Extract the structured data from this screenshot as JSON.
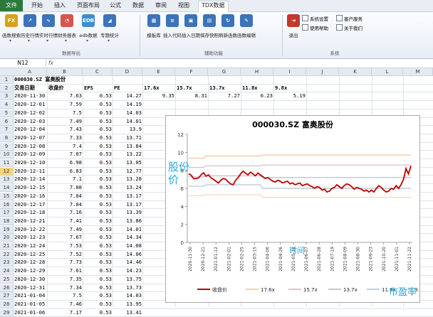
{
  "menu": {
    "items": [
      "文件",
      "开始",
      "插入",
      "页面布局",
      "公式",
      "数据",
      "审阅",
      "视图",
      "TDX数据"
    ]
  },
  "ribbon": {
    "buttons": [
      {
        "icon": "FX",
        "label": "函数搜索",
        "color": "#d7a21a"
      },
      {
        "icon": "↗",
        "label": "历史行情",
        "color": "#3b74b8"
      },
      {
        "icon": "∿",
        "label": "实时行情",
        "color": "#3b74b8"
      },
      {
        "icon": "◔",
        "label": "财务报表",
        "color": "#d9534f"
      },
      {
        "icon": "EDB",
        "label": "edb数据",
        "color": "#3b8fd0"
      },
      {
        "icon": "◢",
        "label": "专题统计",
        "color": "#3b74b8"
      },
      {
        "icon": "▦",
        "label": "模板库",
        "color": "#3b74b8"
      },
      {
        "icon": "≡",
        "label": "插入代码",
        "color": "#3b74b8"
      },
      {
        "icon": "▣",
        "label": "插入日期",
        "color": "#3b74b8"
      },
      {
        "icon": "▤",
        "label": "保存快照",
        "color": "#3b74b8"
      },
      {
        "icon": "↻",
        "label": "刷新函数",
        "color": "#3b74b8"
      },
      {
        "icon": "✎",
        "label": "函数编辑",
        "color": "#3b74b8"
      },
      {
        "icon": "⇥",
        "label": "退出",
        "color": "#c0392b"
      }
    ],
    "small_buttons": [
      "系统设置",
      "使用帮助",
      "客户服务",
      "关于我们"
    ],
    "groups": [
      "数据导出",
      "辅助功能",
      "系统"
    ]
  },
  "formula_bar": {
    "name_box": "N12",
    "fx": "fx"
  },
  "sheet": {
    "columns": [
      "A",
      "B",
      "C",
      "D",
      "E",
      "F",
      "G",
      "H",
      "I",
      "J",
      "K",
      "L",
      "M"
    ],
    "selected_row": "12",
    "header_row1": "000030.SZ  富奥股份",
    "header_row2": [
      "交易日期",
      "收盘价",
      "EPS",
      "PE"
    ],
    "pe_levels": [
      "17.6x",
      "15.7x",
      "13.7x",
      "11.8x",
      "9.8x"
    ],
    "pe_prices": [
      "9.35",
      "8.31",
      "7.27",
      "6.23",
      "5.19"
    ],
    "rows": [
      [
        "2020-11-30",
        "7.63",
        "0.53",
        "14.27"
      ],
      [
        "2020-12-01",
        "7.59",
        "0.53",
        "14.19"
      ],
      [
        "2020-12-02",
        "7.5",
        "0.53",
        "14.03"
      ],
      [
        "2020-12-03",
        "7.49",
        "0.53",
        "14.01"
      ],
      [
        "2020-12-04",
        "7.43",
        "0.53",
        "13.9"
      ],
      [
        "2020-12-07",
        "7.33",
        "0.53",
        "13.71"
      ],
      [
        "2020-12-08",
        "7.4",
        "0.53",
        "13.84"
      ],
      [
        "2020-12-09",
        "7.07",
        "0.53",
        "13.22"
      ],
      [
        "2020-12-10",
        "6.98",
        "0.53",
        "13.05"
      ],
      [
        "2020-12-11",
        "6.83",
        "0.53",
        "12.77"
      ],
      [
        "2020-12-14",
        "7.1",
        "0.53",
        "13.28"
      ],
      [
        "2020-12-15",
        "7.08",
        "0.53",
        "13.24"
      ],
      [
        "2020-12-16",
        "7.04",
        "0.53",
        "13.17"
      ],
      [
        "2020-12-17",
        "7.04",
        "0.53",
        "13.17"
      ],
      [
        "2020-12-18",
        "7.16",
        "0.53",
        "13.39"
      ],
      [
        "2020-12-21",
        "7.41",
        "0.53",
        "13.86"
      ],
      [
        "2020-12-22",
        "7.49",
        "0.53",
        "14.01"
      ],
      [
        "2020-12-23",
        "7.67",
        "0.53",
        "14.34"
      ],
      [
        "2020-12-24",
        "7.53",
        "0.53",
        "14.08"
      ],
      [
        "2020-12-25",
        "7.52",
        "0.53",
        "14.06"
      ],
      [
        "2020-12-28",
        "7.73",
        "0.53",
        "14.46"
      ],
      [
        "2020-12-29",
        "7.61",
        "0.53",
        "14.23"
      ],
      [
        "2020-12-30",
        "7.35",
        "0.53",
        "13.75"
      ],
      [
        "2020-12-31",
        "7.34",
        "0.53",
        "13.73"
      ],
      [
        "2021-01-04",
        "7.5",
        "0.53",
        "14.03"
      ],
      [
        "2021-01-05",
        "7.46",
        "0.53",
        "13.95"
      ],
      [
        "2021-01-06",
        "7.17",
        "0.53",
        "13.41"
      ]
    ]
  },
  "chart_data": {
    "type": "line",
    "title": "000030.SZ  富奥股份",
    "ylim": [
      0,
      12
    ],
    "yticks": [
      "0",
      "2",
      "4",
      "6",
      "8",
      "10",
      "12"
    ],
    "x_tick_labels": [
      "2020-11-30",
      "2020-12-21",
      "2021-01-12",
      "2021-02-01",
      "2021-02-25",
      "2021-03-15",
      "2021-04-06",
      "2021-04-26",
      "2021-05-18",
      "2021-06-07",
      "2021-06-28",
      "2021-07-19",
      "2021-08-09",
      "2021-08-30",
      "2021-09-23",
      "2021-10-20",
      "2021-11-01",
      "2021-11-22"
    ],
    "series": [
      {
        "name": "收盘价",
        "color": "#c00000",
        "values": [
          7.63,
          7.45,
          7.07,
          7.1,
          7.16,
          7.5,
          7.73,
          7.35,
          7.5,
          7.17,
          7.0,
          6.8,
          6.6,
          6.9,
          7.1,
          7.0,
          6.7,
          6.5,
          6.4,
          6.9,
          7.2,
          7.6,
          7.9,
          7.7,
          7.5,
          7.8,
          7.6,
          7.4,
          7.7,
          7.5,
          7.3,
          7.1,
          7.2,
          7.0,
          6.8,
          6.7,
          6.9,
          6.8,
          6.6,
          6.7,
          6.8,
          6.5,
          6.6,
          6.4,
          6.5,
          6.6,
          6.3,
          6.4,
          6.5,
          6.3,
          6.2,
          6.0,
          6.2,
          6.1,
          5.8,
          5.9,
          5.6,
          5.7,
          6.0,
          6.1,
          6.4,
          6.2,
          6.0,
          6.3,
          6.5,
          6.4,
          6.2,
          5.9,
          6.1,
          6.0,
          5.9,
          5.7,
          5.8,
          5.6,
          5.8,
          5.6,
          6.0,
          6.3,
          6.1,
          5.8,
          5.6,
          5.7,
          6.0,
          5.9,
          6.3,
          6.0,
          6.4,
          7.0,
          8.2,
          7.6,
          8.5
        ]
      },
      {
        "name": "17.6x",
        "color": "#f0b27a",
        "values": [
          9.35,
          9.35,
          9.35,
          9.35,
          9.35,
          9.35,
          9.35,
          9.6,
          9.6,
          9.6,
          9.6,
          9.6,
          9.6,
          9.6,
          9.6,
          9.6,
          9.6,
          9.6,
          9.6,
          9.6,
          9.6,
          9.6,
          9.6,
          9.6,
          9.6,
          9.6,
          9.6,
          9.6,
          9.6,
          9.6,
          9.7,
          9.7,
          9.7,
          9.7,
          9.7,
          9.7,
          9.7,
          9.7,
          9.7,
          9.7,
          9.7,
          9.7,
          9.7,
          9.7,
          9.7,
          9.7,
          9.7,
          9.7,
          9.7,
          9.7,
          9.7,
          9.7,
          9.7,
          9.7,
          9.7,
          9.7,
          9.7,
          9.7,
          9.7,
          9.7,
          9.7,
          9.7,
          9.7,
          9.7,
          9.7,
          9.7,
          9.7,
          9.7,
          9.7,
          9.7,
          9.7,
          9.7,
          9.7,
          9.7,
          9.7,
          9.7,
          9.7,
          9.7,
          9.7,
          9.7,
          9.7,
          9.7,
          9.7,
          9.7,
          9.7,
          9.7,
          9.7,
          9.7,
          9.7,
          9.7,
          9.7
        ]
      },
      {
        "name": "15.7x",
        "color": "#c9a4a4",
        "values": [
          8.31,
          8.31,
          8.31,
          8.31,
          8.31,
          8.31,
          8.31,
          8.5,
          8.5,
          8.5,
          8.5,
          8.5,
          8.5,
          8.5,
          8.5,
          8.5,
          8.5,
          8.5,
          8.5,
          8.5,
          8.5,
          8.5,
          8.5,
          8.5,
          8.5,
          8.5,
          8.5,
          8.5,
          8.5,
          8.5,
          8.6,
          8.6,
          8.6,
          8.6,
          8.6,
          8.6,
          8.6,
          8.6,
          8.6,
          8.6,
          8.6,
          8.6,
          8.6,
          8.6,
          8.6,
          8.6,
          8.6,
          8.6,
          8.6,
          8.6,
          8.6,
          8.6,
          8.6,
          8.6,
          8.6,
          8.6,
          8.6,
          8.6,
          8.6,
          8.6,
          8.6,
          8.6,
          8.6,
          8.6,
          8.6,
          8.6,
          8.6,
          8.6,
          8.6,
          8.6,
          8.6,
          8.6,
          8.6,
          8.6,
          8.6,
          8.6,
          8.6,
          8.6,
          8.6,
          8.6,
          8.6,
          8.6,
          8.6,
          8.6,
          8.6,
          8.6,
          8.6,
          8.6,
          8.6,
          8.6,
          8.6
        ]
      },
      {
        "name": "13.7x",
        "color": "#9fa6b0",
        "values": [
          7.27,
          7.27,
          7.27,
          7.27,
          7.27,
          7.27,
          7.27,
          7.4,
          7.4,
          7.4,
          7.4,
          7.4,
          7.4,
          7.4,
          7.4,
          7.4,
          7.4,
          7.4,
          7.4,
          7.4,
          7.4,
          7.4,
          7.4,
          7.4,
          7.4,
          7.4,
          7.4,
          7.4,
          7.4,
          7.4,
          7.2,
          7.2,
          7.2,
          7.2,
          7.2,
          7.2,
          7.2,
          7.2,
          7.2,
          7.2,
          7.2,
          7.2,
          7.2,
          7.2,
          7.2,
          7.2,
          7.2,
          7.2,
          7.2,
          7.2,
          7.2,
          7.2,
          7.2,
          7.2,
          7.2,
          7.2,
          7.2,
          7.2,
          7.2,
          7.2,
          7.2,
          7.2,
          7.2,
          7.2,
          7.2,
          7.2,
          7.2,
          7.2,
          7.2,
          7.2,
          7.2,
          7.2,
          7.2,
          7.2,
          7.2,
          7.2,
          7.2,
          7.2,
          7.2,
          7.2,
          7.2,
          7.2,
          7.2,
          7.2,
          7.2,
          7.2,
          7.2,
          7.2,
          7.2,
          7.2,
          7.2
        ]
      },
      {
        "name": "11.8x",
        "color": "#9ab0c6",
        "values": [
          6.23,
          6.23,
          6.23,
          6.23,
          6.23,
          6.23,
          6.23,
          6.4,
          6.4,
          6.4,
          6.4,
          6.4,
          6.4,
          6.4,
          6.4,
          6.4,
          6.4,
          6.4,
          6.4,
          6.4,
          6.4,
          6.4,
          6.4,
          6.4,
          6.4,
          6.4,
          6.4,
          6.4,
          6.4,
          6.4,
          6.0,
          6.0,
          6.0,
          6.0,
          6.0,
          6.0,
          6.0,
          6.0,
          6.0,
          6.0,
          6.0,
          6.0,
          6.0,
          6.0,
          6.0,
          6.0,
          6.0,
          6.0,
          6.0,
          6.0,
          6.0,
          6.0,
          6.0,
          6.0,
          6.0,
          6.0,
          6.0,
          6.0,
          6.0,
          6.0,
          6.0,
          6.0,
          6.0,
          6.0,
          6.0,
          6.0,
          6.0,
          6.0,
          6.0,
          6.0,
          6.0,
          6.0,
          6.0,
          6.0,
          6.0,
          6.0,
          6.0,
          6.0,
          6.0,
          6.0,
          6.0,
          6.0,
          6.0,
          6.0,
          6.0,
          6.0,
          6.0,
          6.0,
          6.0,
          6.0,
          6.0
        ]
      },
      {
        "name": "9.8x",
        "color": "#f2c9a0",
        "values": [
          5.19,
          5.19,
          5.19,
          5.19,
          5.19,
          5.19,
          5.19,
          5.3,
          5.3,
          5.3,
          5.3,
          5.3,
          5.3,
          5.3,
          5.3,
          5.3,
          5.3,
          5.3,
          5.3,
          5.3,
          5.3,
          5.3,
          5.3,
          5.3,
          5.3,
          5.3,
          5.3,
          5.3,
          5.3,
          5.3,
          5.0,
          5.0,
          5.0,
          5.0,
          5.0,
          5.0,
          5.0,
          5.0,
          5.0,
          5.0,
          5.0,
          5.0,
          5.0,
          5.0,
          5.0,
          5.0,
          5.0,
          5.0,
          5.0,
          5.0,
          5.0,
          5.0,
          5.0,
          5.0,
          5.0,
          5.0,
          5.0,
          5.0,
          5.0,
          5.0,
          5.0,
          5.0,
          5.0,
          5.0,
          5.0,
          5.0,
          5.0,
          5.0,
          5.0,
          5.0,
          5.0,
          5.0,
          5.0,
          5.0,
          5.0,
          5.0,
          5.0,
          5.0,
          5.0,
          5.0,
          5.0,
          5.0,
          5.0,
          5.0,
          5.0,
          5.0,
          5.0,
          5.0,
          5.0,
          5.0,
          5.0
        ]
      }
    ],
    "legend_position": "bottom",
    "grid": false
  },
  "watermarks": {
    "left": "股份\n价",
    "mid": "时间",
    "corner": "市盈率"
  },
  "colors": {
    "accent": "#2a7a3c",
    "watermark": "#29a8e0"
  }
}
